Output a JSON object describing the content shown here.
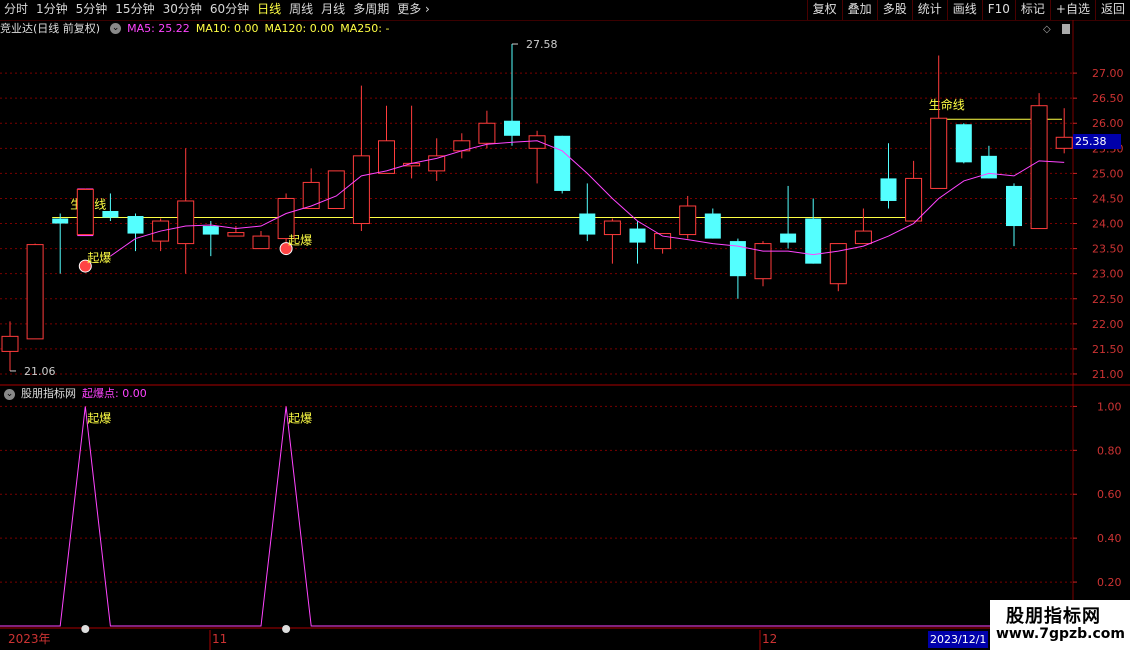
{
  "toolbar": {
    "tabs": [
      "分时",
      "1分钟",
      "5分钟",
      "15分钟",
      "30分钟",
      "60分钟",
      "日线",
      "周线",
      "月线",
      "多周期",
      "更多 ›"
    ],
    "active_tab": "日线",
    "right_buttons": [
      "复权",
      "叠加",
      "多股",
      "统计",
      "画线",
      "F10",
      "标记",
      "+自选",
      "返回"
    ]
  },
  "infobar": {
    "stock": "竞业达(日线 前复权)",
    "ma5": "MA5: 25.22",
    "ma10": "MA10: 0.00",
    "ma120": "MA120: 0.00",
    "ma250": "MA250: -"
  },
  "subinfo": {
    "indicator": "股朋指标网",
    "value": "起爆点: 0.00"
  },
  "current_price": "25.38",
  "watermark": {
    "cn": "股朋指标网",
    "url": "www.7gpzb.com"
  },
  "date_labels": [
    "2023年",
    "11",
    "12",
    "2023/12/1"
  ],
  "colors": {
    "up": "#ff3c3c",
    "down": "#54ffff",
    "ma5": "#ff44ff",
    "lifeline": "#ffff44",
    "marker": "#ff44ff",
    "grid": "#7a0000"
  },
  "chart_data": [
    {
      "type": "candlestick",
      "title": "竞业达(日线 前复权)",
      "ylim": [
        20.8,
        27.7
      ],
      "yticks": [
        21.0,
        21.5,
        22.0,
        22.5,
        23.0,
        23.5,
        24.0,
        24.5,
        25.0,
        25.5,
        26.0,
        26.5,
        27.0
      ],
      "annotations": {
        "high": "27.58",
        "low": "21.06",
        "high_index": 20,
        "low_index": 0
      },
      "candles": [
        {
          "o": 21.45,
          "h": 22.05,
          "l": 21.06,
          "c": 21.75
        },
        {
          "o": 21.7,
          "h": 23.6,
          "l": 21.7,
          "c": 23.58
        },
        {
          "o": 24.1,
          "h": 24.2,
          "l": 23.0,
          "c": 24.0
        },
        {
          "o": 23.78,
          "h": 24.7,
          "l": 23.78,
          "c": 24.68
        },
        {
          "o": 24.25,
          "h": 24.6,
          "l": 24.05,
          "c": 24.12
        },
        {
          "o": 24.15,
          "h": 24.2,
          "l": 23.45,
          "c": 23.8
        },
        {
          "o": 23.65,
          "h": 24.1,
          "l": 23.45,
          "c": 24.05
        },
        {
          "o": 23.6,
          "h": 25.5,
          "l": 23.0,
          "c": 24.45
        },
        {
          "o": 23.95,
          "h": 24.05,
          "l": 23.35,
          "c": 23.78
        },
        {
          "o": 23.75,
          "h": 23.95,
          "l": 23.75,
          "c": 23.82
        },
        {
          "o": 23.5,
          "h": 23.85,
          "l": 23.5,
          "c": 23.75
        },
        {
          "o": 23.7,
          "h": 24.6,
          "l": 23.6,
          "c": 24.5
        },
        {
          "o": 24.3,
          "h": 25.1,
          "l": 24.3,
          "c": 24.82
        },
        {
          "o": 24.3,
          "h": 25.05,
          "l": 24.3,
          "c": 25.05
        },
        {
          "o": 24.0,
          "h": 26.75,
          "l": 23.85,
          "c": 25.35
        },
        {
          "o": 25.0,
          "h": 26.35,
          "l": 25.0,
          "c": 25.65
        },
        {
          "o": 25.15,
          "h": 26.35,
          "l": 24.9,
          "c": 25.2
        },
        {
          "o": 25.05,
          "h": 25.7,
          "l": 24.85,
          "c": 25.35
        },
        {
          "o": 25.45,
          "h": 25.8,
          "l": 25.3,
          "c": 25.65
        },
        {
          "o": 25.6,
          "h": 26.25,
          "l": 25.5,
          "c": 26.0
        },
        {
          "o": 26.05,
          "h": 27.58,
          "l": 25.55,
          "c": 25.75
        },
        {
          "o": 25.5,
          "h": 25.85,
          "l": 24.8,
          "c": 25.75
        },
        {
          "o": 25.75,
          "h": 25.75,
          "l": 24.6,
          "c": 24.65
        },
        {
          "o": 24.2,
          "h": 24.8,
          "l": 23.65,
          "c": 23.78
        },
        {
          "o": 23.78,
          "h": 24.1,
          "l": 23.2,
          "c": 24.05
        },
        {
          "o": 23.9,
          "h": 24.05,
          "l": 23.2,
          "c": 23.62
        },
        {
          "o": 23.5,
          "h": 23.8,
          "l": 23.4,
          "c": 23.8
        },
        {
          "o": 23.78,
          "h": 24.55,
          "l": 23.7,
          "c": 24.35
        },
        {
          "o": 24.2,
          "h": 24.3,
          "l": 23.7,
          "c": 23.7
        },
        {
          "o": 23.65,
          "h": 23.7,
          "l": 22.5,
          "c": 22.95
        },
        {
          "o": 22.9,
          "h": 23.65,
          "l": 22.75,
          "c": 23.6
        },
        {
          "o": 23.8,
          "h": 24.75,
          "l": 23.5,
          "c": 23.62
        },
        {
          "o": 24.1,
          "h": 24.5,
          "l": 23.2,
          "c": 23.2
        },
        {
          "o": 22.8,
          "h": 23.6,
          "l": 22.65,
          "c": 23.6
        },
        {
          "o": 23.6,
          "h": 24.3,
          "l": 23.6,
          "c": 23.85
        },
        {
          "o": 24.9,
          "h": 25.6,
          "l": 24.3,
          "c": 24.45
        },
        {
          "o": 24.05,
          "h": 25.25,
          "l": 24.05,
          "c": 24.9
        },
        {
          "o": 24.7,
          "h": 27.35,
          "l": 24.7,
          "c": 26.1
        },
        {
          "o": 25.98,
          "h": 26.0,
          "l": 25.2,
          "c": 25.22
        },
        {
          "o": 25.35,
          "h": 25.55,
          "l": 24.9,
          "c": 24.9
        },
        {
          "o": 24.75,
          "h": 24.8,
          "l": 23.55,
          "c": 23.95
        },
        {
          "o": 23.9,
          "h": 26.6,
          "l": 23.9,
          "c": 26.35
        },
        {
          "o": 25.5,
          "h": 26.3,
          "l": 25.4,
          "c": 25.72
        }
      ],
      "ma5": [
        null,
        null,
        null,
        null,
        23.35,
        23.7,
        23.85,
        23.95,
        23.97,
        23.9,
        23.95,
        24.2,
        24.35,
        24.55,
        24.95,
        25.05,
        25.2,
        25.3,
        25.45,
        25.58,
        25.62,
        25.65,
        25.45,
        25.0,
        24.5,
        24.05,
        23.75,
        23.68,
        23.6,
        23.55,
        23.45,
        23.45,
        23.38,
        23.45,
        23.55,
        23.75,
        24.0,
        24.5,
        24.85,
        25.0,
        24.95,
        25.25,
        25.22
      ],
      "lifelines": [
        {
          "label": "生命线",
          "value": 24.12,
          "from": 2,
          "to": 36
        },
        {
          "label": "生命线",
          "value": 26.08,
          "from": 37,
          "to": 42
        }
      ],
      "markers": [
        {
          "label": "起爆",
          "index": 3,
          "bar_top": 24.7,
          "bar_bottom": 23.75
        },
        {
          "label": "起爆",
          "index": 11,
          "bar_top": 24.5,
          "bar_bottom": 23.7
        }
      ]
    },
    {
      "type": "line",
      "title": "股朋指标网",
      "series": [
        {
          "name": "起爆点",
          "spikes_at": [
            3,
            11
          ],
          "peak": 1.0,
          "base": 0.0
        }
      ],
      "ylim": [
        0.0,
        1.1
      ],
      "yticks": [
        0.2,
        0.4,
        0.6,
        0.8,
        1.0
      ],
      "annotations": [
        "起爆",
        "起爆"
      ]
    }
  ]
}
